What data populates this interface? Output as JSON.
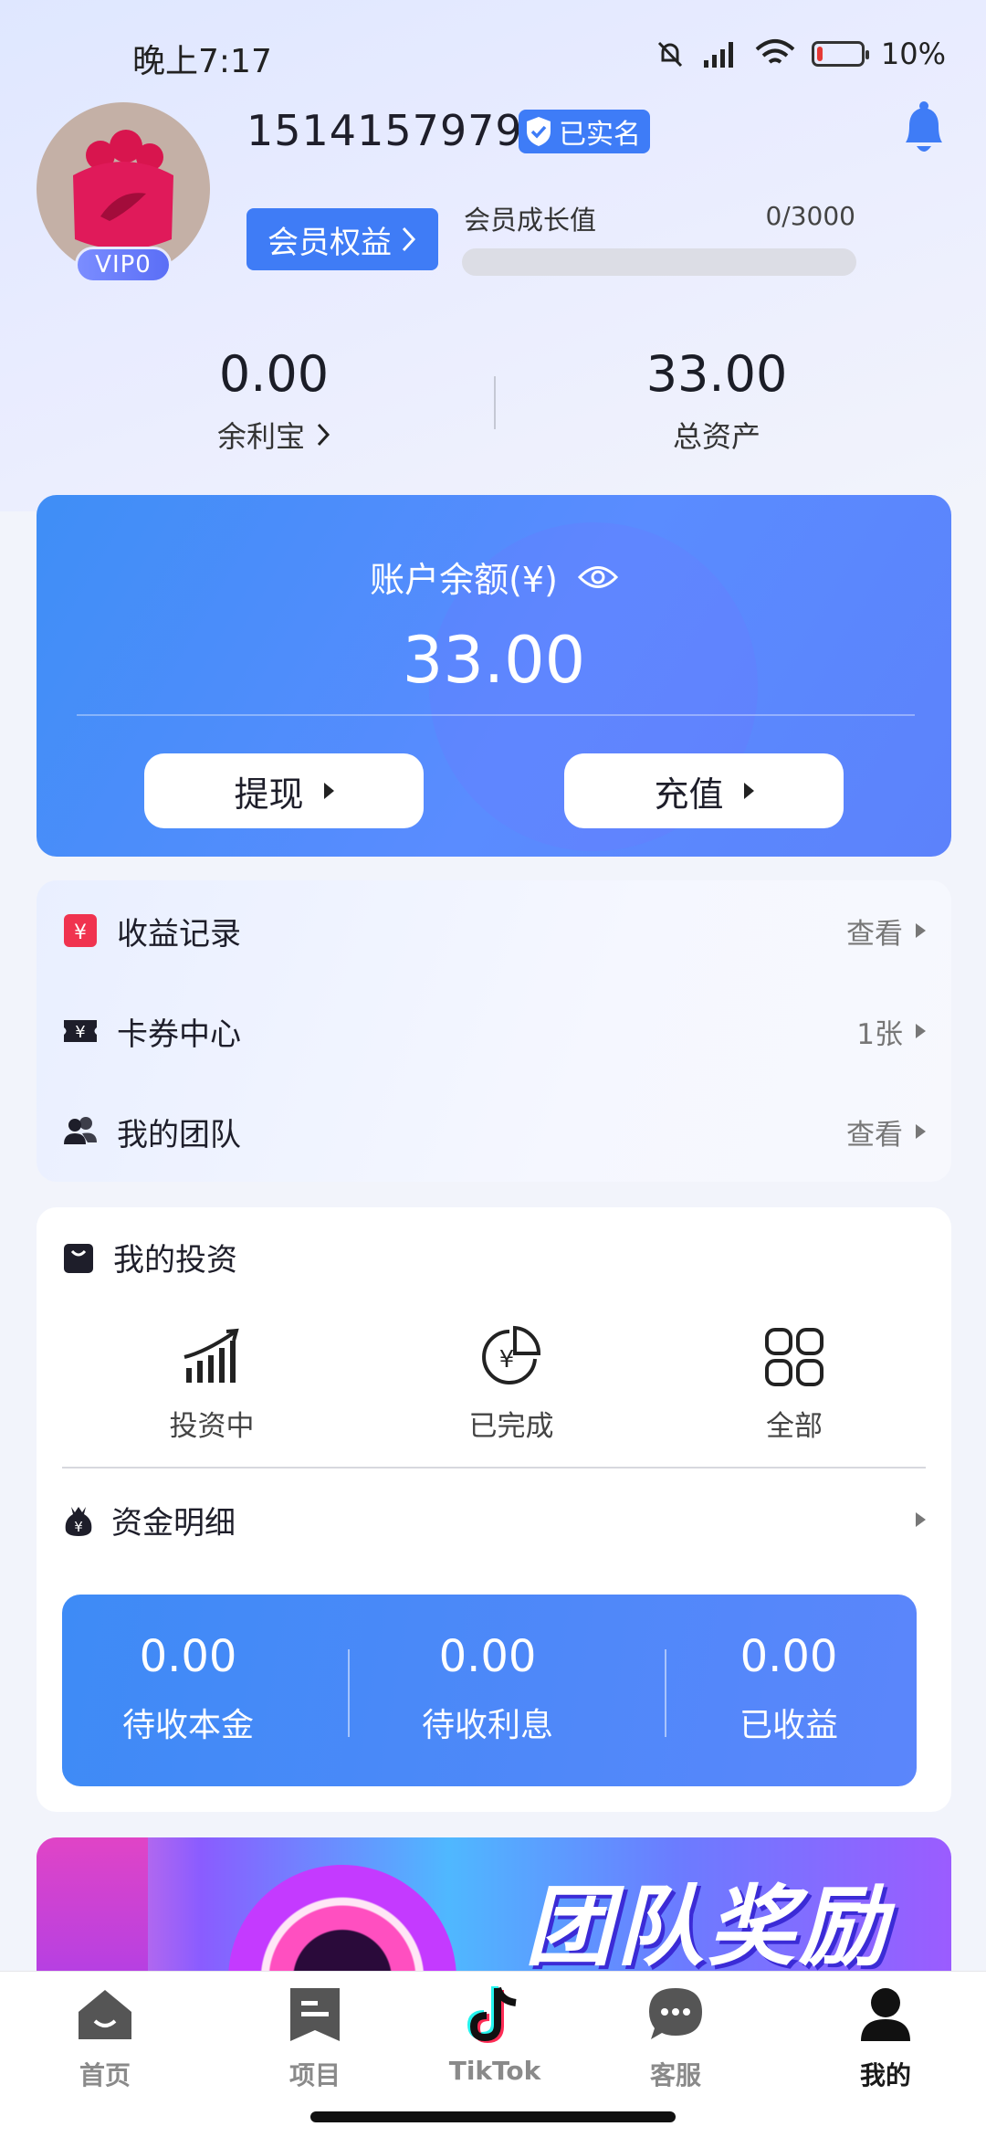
{
  "status_bar": {
    "time": "晚上7:17",
    "battery": "10%",
    "battery_level": 0.1
  },
  "profile": {
    "phone": "15141579793",
    "verified_label": "已实名",
    "vip_label": "VIP0",
    "member_button": "会员权益",
    "growth_label": "会员成长值",
    "growth_value": "0/3000",
    "growth_progress": 0
  },
  "stats": {
    "yulibao": {
      "value": "0.00",
      "label": "余利宝"
    },
    "total_assets": {
      "value": "33.00",
      "label": "总资产"
    }
  },
  "balance": {
    "title": "账户余额(¥)",
    "amount": "33.00",
    "withdraw": "提现",
    "recharge": "充值"
  },
  "menu": [
    {
      "label": "收益记录",
      "right": "查看"
    },
    {
      "label": "卡券中心",
      "right": "1张"
    },
    {
      "label": "我的团队",
      "right": "查看"
    }
  ],
  "investment": {
    "title": "我的投资",
    "items": [
      {
        "label": "投资中"
      },
      {
        "label": "已完成"
      },
      {
        "label": "全部"
      }
    ],
    "fund_title": "资金明细",
    "fund": [
      {
        "value": "0.00",
        "label": "待收本金"
      },
      {
        "value": "0.00",
        "label": "待收利息"
      },
      {
        "value": "0.00",
        "label": "已收益"
      }
    ]
  },
  "banner": {
    "text": "团队奖励"
  },
  "nav": [
    {
      "label": "首页"
    },
    {
      "label": "项目"
    },
    {
      "label": "TikTok"
    },
    {
      "label": "客服"
    },
    {
      "label": "我的"
    }
  ],
  "colors": {
    "accent": "#3f7cf6",
    "card_blue": "#4f8cf8"
  }
}
